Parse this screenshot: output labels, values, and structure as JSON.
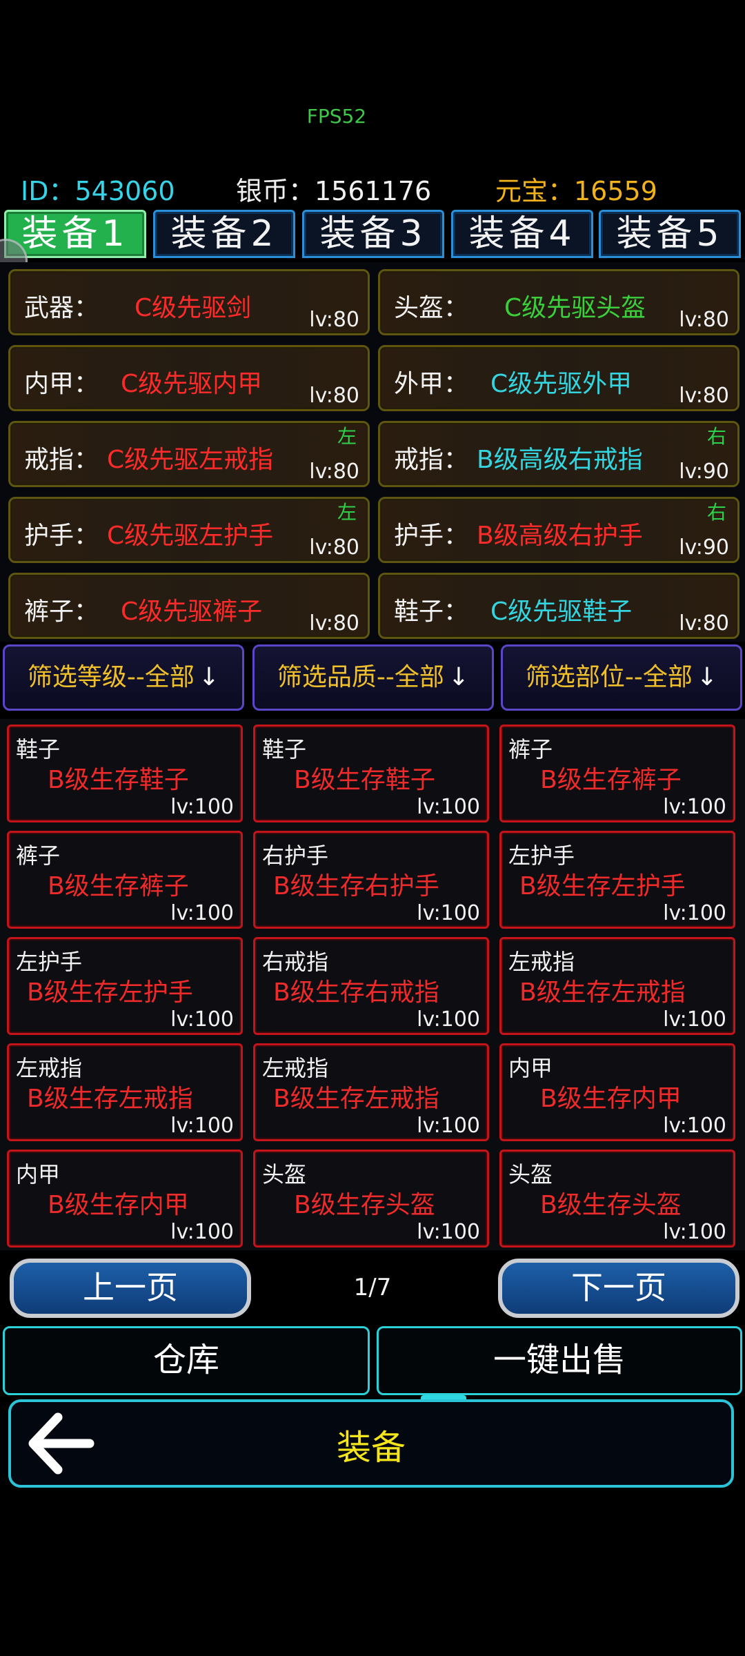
{
  "fps": "FPS52",
  "stats": {
    "id": "ID：543060",
    "silver": "银币：1561176",
    "ingot": "元宝：16559"
  },
  "tabs": [
    "装备1",
    "装备2",
    "装备3",
    "装备4",
    "装备5"
  ],
  "active_tab_index": 0,
  "equipped": [
    {
      "label": "武器：",
      "name": "C级先驱剑",
      "level": "lv:80",
      "color": "#ff2b2b",
      "side": ""
    },
    {
      "label": "头盔：",
      "name": "C级先驱头盔",
      "level": "lv:80",
      "color": "#3bd03b",
      "side": ""
    },
    {
      "label": "内甲：",
      "name": "C级先驱内甲",
      "level": "lv:80",
      "color": "#ff2b2b",
      "side": ""
    },
    {
      "label": "外甲：",
      "name": "C级先驱外甲",
      "level": "lv:80",
      "color": "#33d6e0",
      "side": ""
    },
    {
      "label": "戒指：",
      "name": "C级先驱左戒指",
      "level": "lv:80",
      "color": "#ff2b2b",
      "side": "左"
    },
    {
      "label": "戒指：",
      "name": "B级高级右戒指",
      "level": "lv:90",
      "color": "#33d6e0",
      "side": "右"
    },
    {
      "label": "护手：",
      "name": "C级先驱左护手",
      "level": "lv:80",
      "color": "#ff2b2b",
      "side": "左"
    },
    {
      "label": "护手：",
      "name": "B级高级右护手",
      "level": "lv:90",
      "color": "#ff2b2b",
      "side": "右"
    },
    {
      "label": "裤子：",
      "name": "C级先驱裤子",
      "level": "lv:80",
      "color": "#ff2b2b",
      "side": ""
    },
    {
      "label": "鞋子：",
      "name": "C级先驱鞋子",
      "level": "lv:80",
      "color": "#33d6e0",
      "side": ""
    }
  ],
  "filters": {
    "level": "筛选等级--全部",
    "quality": "筛选品质--全部",
    "slot": "筛选部位--全部",
    "arrow": "↓"
  },
  "inventory": [
    {
      "type": "鞋子",
      "name": "B级生存鞋子",
      "level": "lv:100"
    },
    {
      "type": "鞋子",
      "name": "B级生存鞋子",
      "level": "lv:100"
    },
    {
      "type": "裤子",
      "name": "B级生存裤子",
      "level": "lv:100"
    },
    {
      "type": "裤子",
      "name": "B级生存裤子",
      "level": "lv:100"
    },
    {
      "type": "右护手",
      "name": "B级生存右护手",
      "level": "lv:100"
    },
    {
      "type": "左护手",
      "name": "B级生存左护手",
      "level": "lv:100"
    },
    {
      "type": "左护手",
      "name": "B级生存左护手",
      "level": "lv:100"
    },
    {
      "type": "右戒指",
      "name": "B级生存右戒指",
      "level": "lv:100"
    },
    {
      "type": "左戒指",
      "name": "B级生存左戒指",
      "level": "lv:100"
    },
    {
      "type": "左戒指",
      "name": "B级生存左戒指",
      "level": "lv:100"
    },
    {
      "type": "左戒指",
      "name": "B级生存左戒指",
      "level": "lv:100"
    },
    {
      "type": "内甲",
      "name": "B级生存内甲",
      "level": "lv:100"
    },
    {
      "type": "内甲",
      "name": "B级生存内甲",
      "level": "lv:100"
    },
    {
      "type": "头盔",
      "name": "B级生存头盔",
      "level": "lv:100"
    },
    {
      "type": "头盔",
      "name": "B级生存头盔",
      "level": "lv:100"
    }
  ],
  "pagination": {
    "prev": "上一页",
    "next": "下一页",
    "indicator": "1/7"
  },
  "actions": {
    "warehouse": "仓库",
    "sell_all": "一键出售"
  },
  "footer": {
    "title": "装备",
    "back_icon": "back-arrow-icon"
  }
}
